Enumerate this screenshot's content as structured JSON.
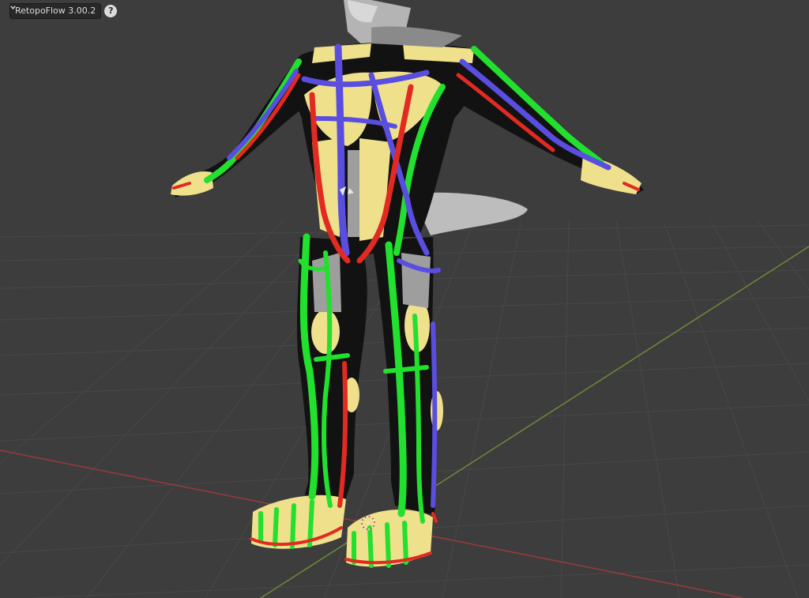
{
  "header": {
    "addon_label": "RetopoFlow 3.00.2",
    "help_glyph": "?"
  },
  "viewport": {
    "background_color": "#3d3d3d",
    "grid_color": "#4a4a4a",
    "x_axis_color": "#9a3b3b",
    "y_axis_color": "#6d8a35",
    "model": "character mesh with retopology strokes",
    "stroke_colors": {
      "green": "#22e02e",
      "blue": "#5a4ee0",
      "red": "#e02a22",
      "yellow": "#efe08c",
      "black": "#121212",
      "mesh": "#a6a6a6"
    }
  },
  "icons": {
    "dropdown": "chevron-down-icon",
    "help": "help-icon",
    "cursor": "3d-cursor-icon"
  }
}
